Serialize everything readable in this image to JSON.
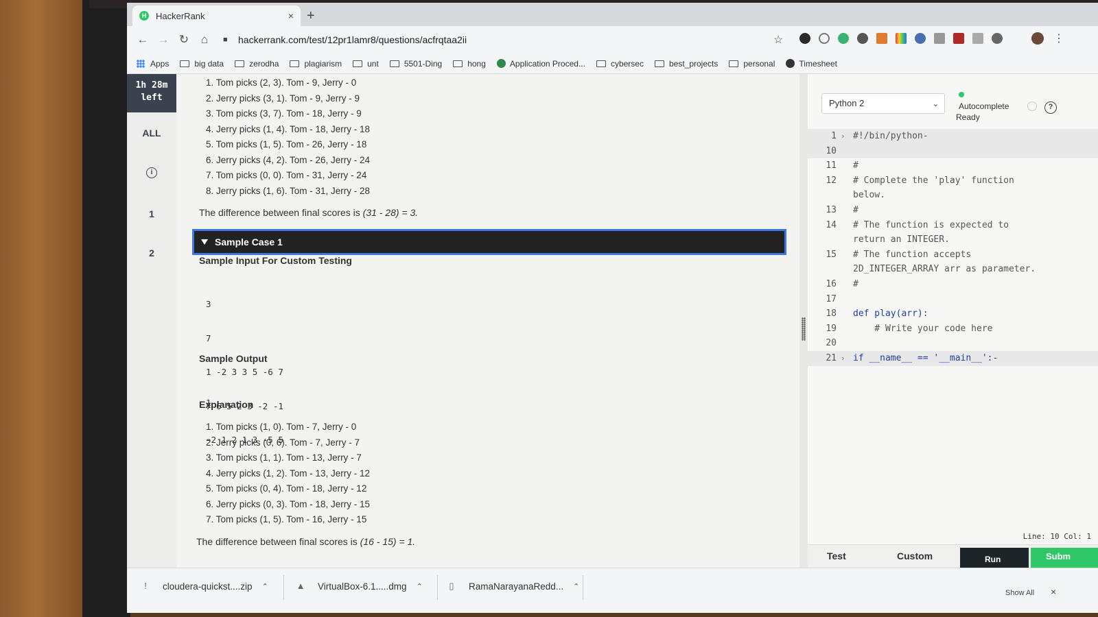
{
  "browser": {
    "tab_title": "HackerRank",
    "tab_close": "×",
    "new_tab": "+",
    "url": "hackerrank.com/test/12pr1lamr8/questions/acfrqtaa2ii"
  },
  "bookmarks": [
    "Apps",
    "big data",
    "zerodha",
    "plagiarism",
    "unt",
    "5501-Ding",
    "hong",
    "Application Proced...",
    "cybersec",
    "best_projects",
    "personal",
    "Timesheet"
  ],
  "timer": {
    "line1": "1h 28m",
    "line2": "left"
  },
  "nav": {
    "all": "ALL",
    "q1": "1",
    "q2": "2"
  },
  "sample0": {
    "steps": [
      "1. Tom picks (2, 3). Tom - 9, Jerry - 0",
      "2. Jerry picks (3, 1). Tom - 9, Jerry - 9",
      "3. Tom picks (3, 7). Tom - 18, Jerry - 9",
      "4. Jerry picks (1, 4). Tom - 18, Jerry - 18",
      "5. Tom picks (1, 5). Tom - 26, Jerry - 18",
      "6. Jerry picks (4, 2). Tom - 26, Jerry - 24",
      "7. Tom picks (0, 0). Tom - 31, Jerry - 24",
      "8. Jerry picks (1, 6). Tom - 31, Jerry - 28"
    ],
    "diff_text": "The difference between final scores is ",
    "diff_expr": "(31 - 28) = 3."
  },
  "sample1": {
    "title": "Sample Case 1",
    "input_heading": "Sample Input For Custom Testing",
    "input_lines": [
      "3",
      "7",
      "1 -2 3 3 5 -6 7",
      "7 6 5 2 3 -2 -1",
      "-2 1 2 1 3 -5 5"
    ],
    "output_heading": "Sample Output",
    "output": "1",
    "explanation_heading": "Explanation",
    "steps": [
      "1. Tom picks (1, 0). Tom - 7, Jerry - 0",
      "2. Jerry picks (0, 6). Tom - 7, Jerry - 7",
      "3. Tom picks (1, 1). Tom - 13, Jerry - 7",
      "4. Jerry picks (1, 2). Tom - 13, Jerry - 12",
      "5. Tom picks (0, 4). Tom - 18, Jerry - 12",
      "6. Jerry picks (0, 3). Tom - 18, Jerry - 15",
      "7. Tom picks (1, 5). Tom - 16, Jerry - 15"
    ],
    "diff_text": "The difference between final scores is ",
    "diff_expr": "(16 - 15) = 1."
  },
  "editor": {
    "language": "Python 2",
    "autocomplete": "Autocomplete",
    "ready": "Ready",
    "lines": [
      {
        "n": "1",
        "fold": "›",
        "text": "#!/bin/python-",
        "kw": false,
        "hl": true
      },
      {
        "n": "10",
        "fold": "",
        "text": "",
        "kw": false,
        "hl": true
      },
      {
        "n": "11",
        "fold": "",
        "text": "#",
        "kw": false,
        "hl": false
      },
      {
        "n": "12",
        "fold": "",
        "text": "# Complete the 'play' function",
        "kw": false,
        "hl": false
      },
      {
        "n": "",
        "fold": "",
        "text": "below.",
        "kw": false,
        "hl": false
      },
      {
        "n": "13",
        "fold": "",
        "text": "#",
        "kw": false,
        "hl": false
      },
      {
        "n": "14",
        "fold": "",
        "text": "# The function is expected to",
        "kw": false,
        "hl": false
      },
      {
        "n": "",
        "fold": "",
        "text": "return an INTEGER.",
        "kw": false,
        "hl": false
      },
      {
        "n": "15",
        "fold": "",
        "text": "# The function accepts",
        "kw": false,
        "hl": false
      },
      {
        "n": "",
        "fold": "",
        "text": "2D_INTEGER_ARRAY arr as parameter.",
        "kw": false,
        "hl": false
      },
      {
        "n": "16",
        "fold": "",
        "text": "#",
        "kw": false,
        "hl": false
      },
      {
        "n": "17",
        "fold": "",
        "text": "",
        "kw": false,
        "hl": false
      },
      {
        "n": "18",
        "fold": "",
        "text": "def play(arr):",
        "kw": true,
        "hl": false
      },
      {
        "n": "19",
        "fold": "",
        "text": "    # Write your code here",
        "kw": false,
        "hl": false
      },
      {
        "n": "20",
        "fold": "",
        "text": "",
        "kw": false,
        "hl": false
      },
      {
        "n": "21",
        "fold": "›",
        "text": "if __name__ == '__main__':-",
        "kw": true,
        "hl": true
      }
    ],
    "status": "Line: 10 Col: 1",
    "tab_test": "Test",
    "tab_custom": "Custom",
    "run": "Run",
    "submit": "Subm"
  },
  "downloads": [
    {
      "name": "cloudera-quickst....zip",
      "icon": "!"
    },
    {
      "name": "VirtualBox-6.1.....dmg",
      "icon": "▲"
    },
    {
      "name": "RamaNarayanaRedd...",
      "icon": "▯"
    }
  ],
  "downloads_show_all": "Show All",
  "downloads_close": "×",
  "colors": {
    "hr_green": "#2ec866",
    "hr_dark": "#39424e",
    "selection_blue": "#3a78e0"
  }
}
